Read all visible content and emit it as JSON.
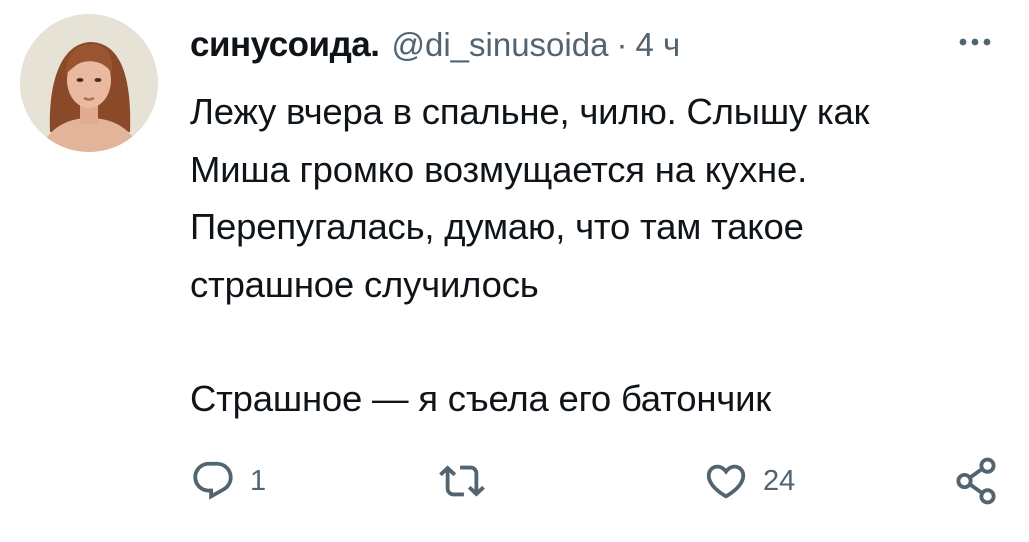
{
  "tweet": {
    "author_name": "синусоида.",
    "handle": "@di_sinusoida",
    "separator": "·",
    "time": "4 ч",
    "text_lines": [
      "Лежу вчера в спальне, чилю. Слышу как",
      "Миша громко возмущается на кухне.",
      "Перепугалась, думаю, что там такое",
      "страшное случилось"
    ],
    "text_last": "Страшное — я съела его батончик"
  },
  "actions": {
    "reply_count": "1",
    "like_count": "24"
  },
  "icons": {
    "more": "more-dots-icon",
    "reply": "reply-icon",
    "retweet": "retweet-icon",
    "like": "heart-icon",
    "share": "share-icon"
  },
  "colors": {
    "text": "#0f1419",
    "secondary": "#536471"
  }
}
